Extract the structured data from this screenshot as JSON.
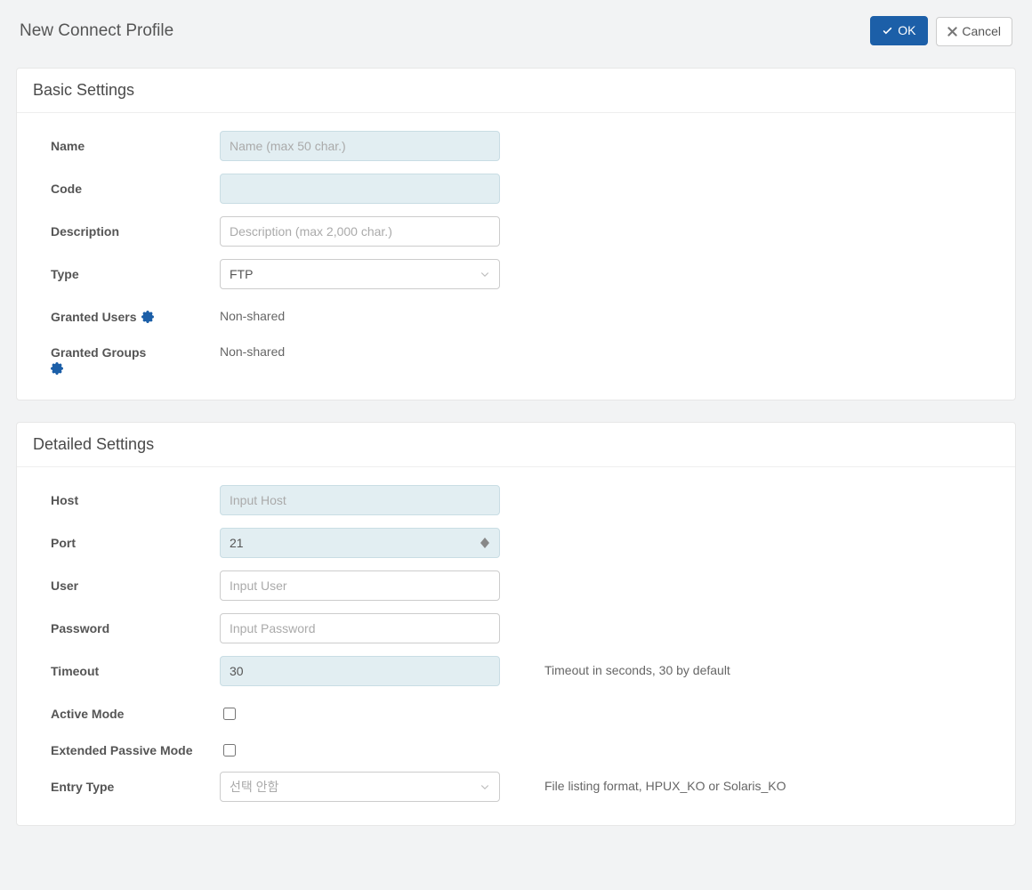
{
  "header": {
    "title": "New Connect Profile",
    "ok_label": "OK",
    "cancel_label": "Cancel"
  },
  "basic": {
    "heading": "Basic Settings",
    "name_label": "Name",
    "name_placeholder": "Name (max 50 char.)",
    "code_label": "Code",
    "description_label": "Description",
    "description_placeholder": "Description (max 2,000 char.)",
    "type_label": "Type",
    "type_value": "FTP",
    "granted_users_label": "Granted Users",
    "granted_users_value": "Non-shared",
    "granted_groups_label": "Granted Groups",
    "granted_groups_value": "Non-shared"
  },
  "detailed": {
    "heading": "Detailed Settings",
    "host_label": "Host",
    "host_placeholder": "Input Host",
    "port_label": "Port",
    "port_value": "21",
    "user_label": "User",
    "user_placeholder": "Input User",
    "password_label": "Password",
    "password_placeholder": "Input Password",
    "timeout_label": "Timeout",
    "timeout_value": "30",
    "timeout_help": "Timeout in seconds, 30 by default",
    "active_mode_label": "Active Mode",
    "epsv_label": "Extended Passive Mode",
    "entry_type_label": "Entry Type",
    "entry_type_placeholder": "선택 안함",
    "entry_type_help": "File listing format, HPUX_KO or Solaris_KO"
  }
}
